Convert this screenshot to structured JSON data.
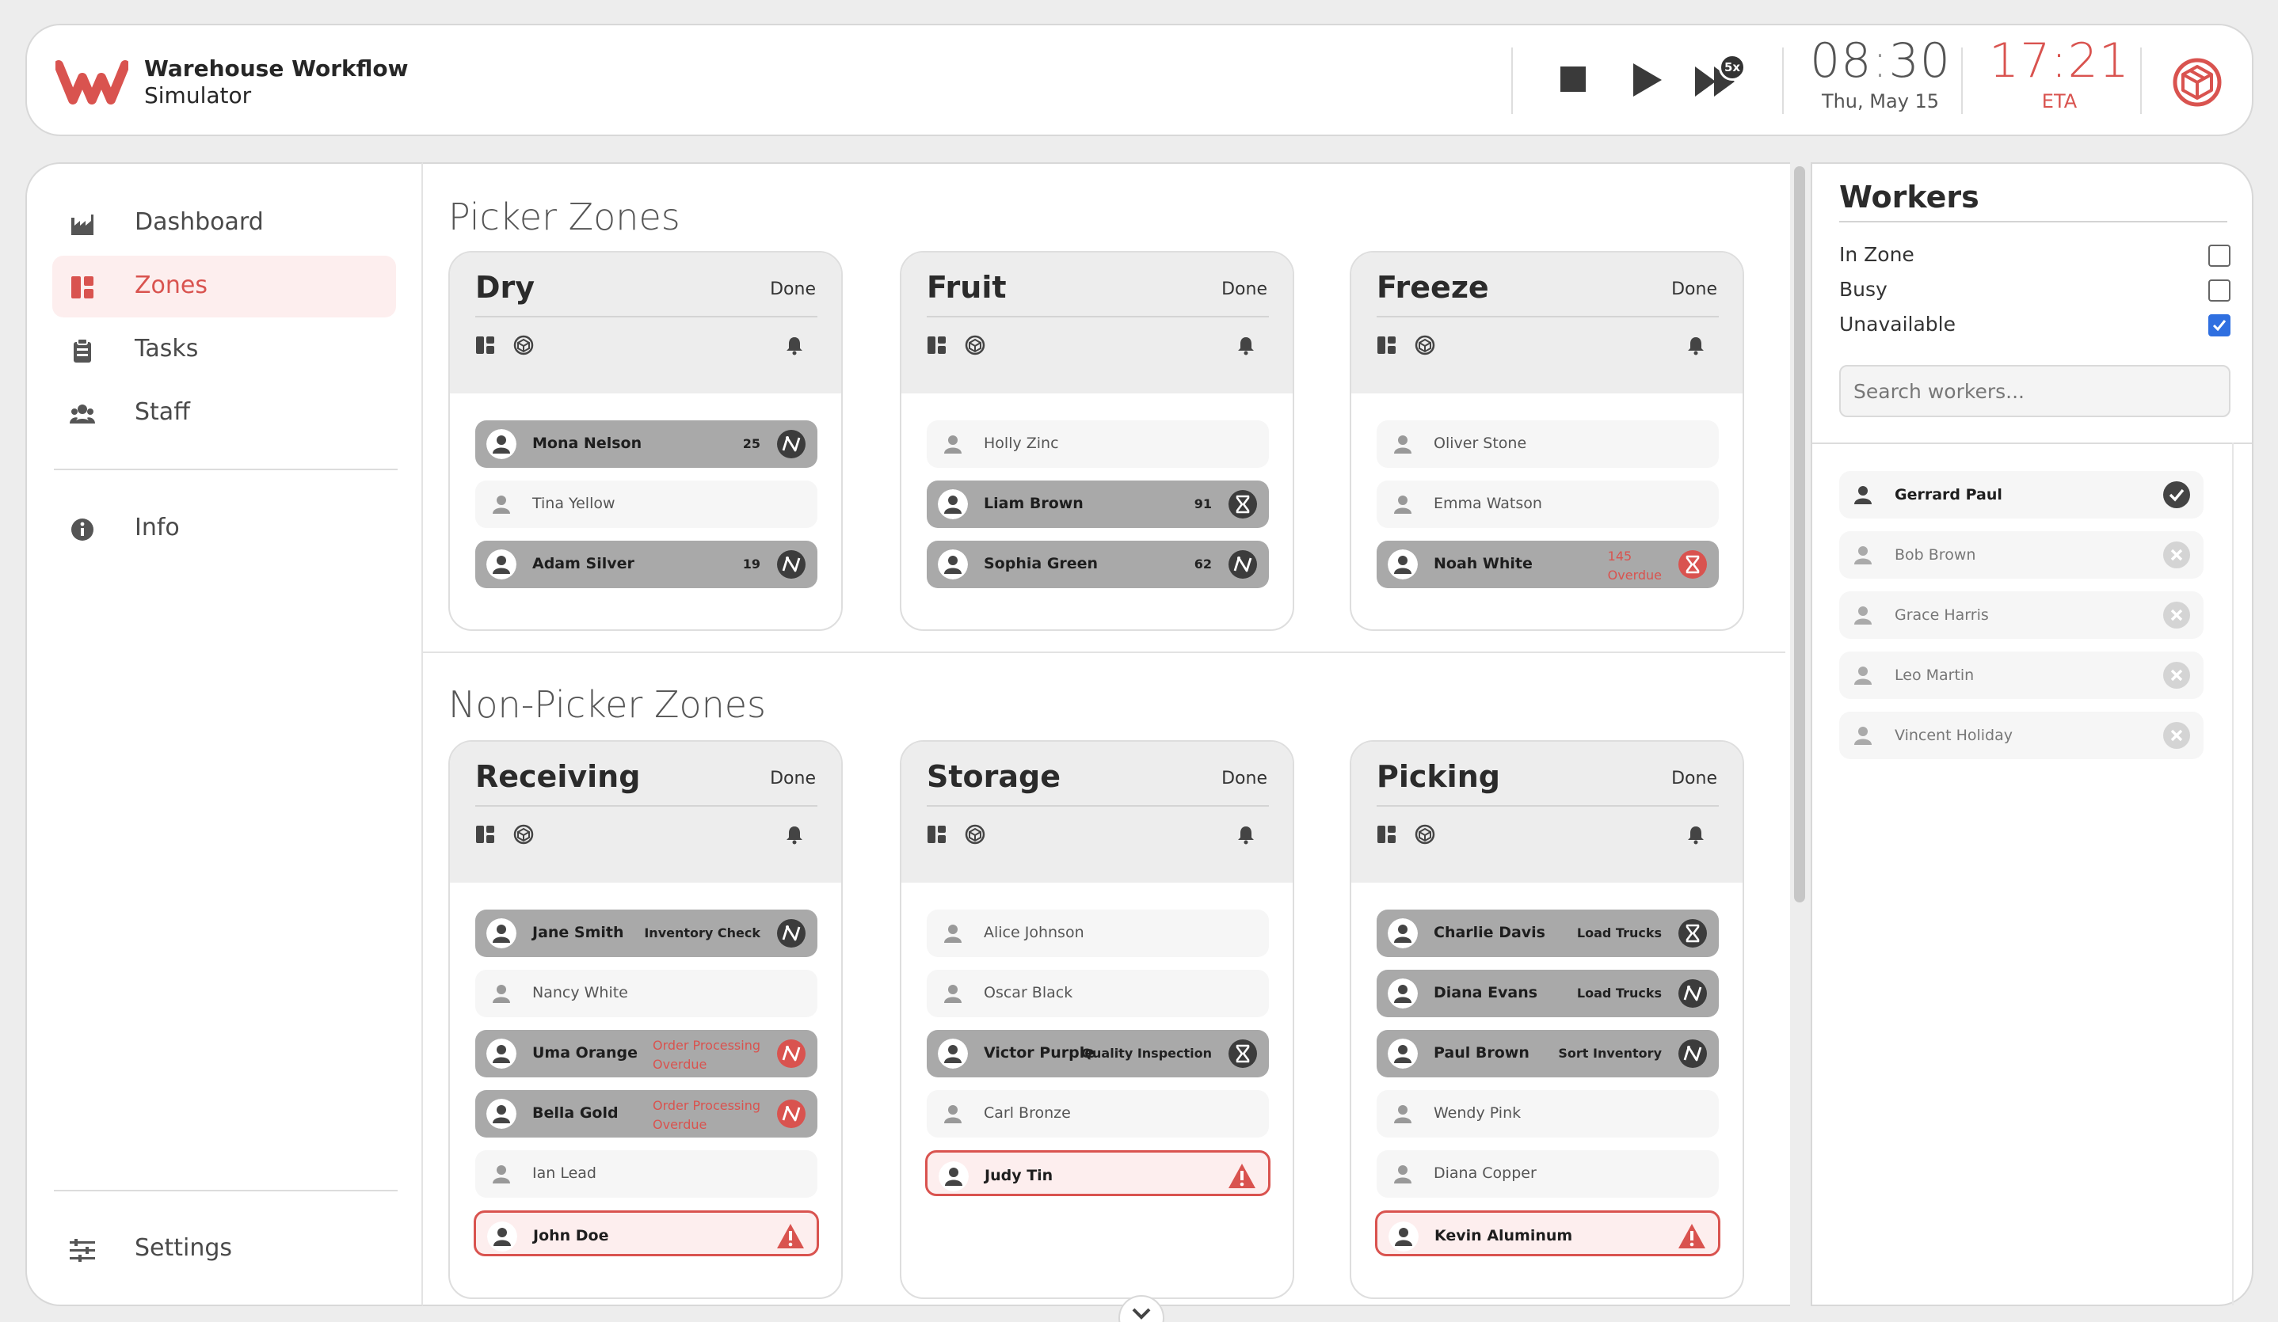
{
  "header": {
    "app_title_line1": "Warehouse Workflow",
    "app_title_line2": "Simulator",
    "clock_hours": "08",
    "clock_minutes": "30",
    "clock_date": "Thu, May 15",
    "eta_time": "17:21",
    "eta_label": "ETA",
    "speed_badge": "5x",
    "accent_color": "#d9534f"
  },
  "nav": {
    "items": [
      {
        "label": "Dashboard",
        "icon": "factory-icon"
      },
      {
        "label": "Zones",
        "icon": "zones-icon",
        "active": true
      },
      {
        "label": "Tasks",
        "icon": "clipboard-icon"
      },
      {
        "label": "Staff",
        "icon": "users-icon"
      }
    ],
    "info_label": "Info",
    "settings_label": "Settings"
  },
  "picker_section_title": "Picker Zones",
  "nonpicker_section_title": "Non-Picker Zones",
  "zones": [
    {
      "name": "Dry",
      "done_label": "Done",
      "workers": [
        {
          "name": "Mona Nelson",
          "task": "25",
          "state": "busy",
          "icon": "route-icon"
        },
        {
          "name": "Tina Yellow",
          "state": "idle"
        },
        {
          "name": "Adam Silver",
          "task": "19",
          "state": "busy",
          "icon": "route-icon"
        }
      ]
    },
    {
      "name": "Fruit",
      "done_label": "Done",
      "workers": [
        {
          "name": "Holly Zinc",
          "state": "idle"
        },
        {
          "name": "Liam Brown",
          "task": "91",
          "state": "busy",
          "icon": "hourglass-icon"
        },
        {
          "name": "Sophia Green",
          "task": "62",
          "state": "busy",
          "icon": "route-icon"
        }
      ]
    },
    {
      "name": "Freeze",
      "done_label": "Done",
      "workers": [
        {
          "name": "Oliver Stone",
          "state": "idle"
        },
        {
          "name": "Emma Watson",
          "state": "idle"
        },
        {
          "name": "Noah White",
          "task": "145",
          "sub": "Overdue",
          "state": "busy-overdue",
          "icon": "hourglass-icon"
        }
      ]
    },
    {
      "name": "Receiving",
      "done_label": "Done",
      "workers": [
        {
          "name": "Jane Smith",
          "task": "Inventory Check",
          "state": "busy",
          "icon": "route-icon"
        },
        {
          "name": "Nancy White",
          "state": "idle"
        },
        {
          "name": "Uma Orange",
          "task": "Order Processing",
          "sub": "Overdue",
          "state": "busy-overdue",
          "icon": "route-icon"
        },
        {
          "name": "Bella Gold",
          "task": "Order Processing",
          "sub": "Overdue",
          "state": "busy-overdue",
          "icon": "route-icon"
        },
        {
          "name": "Ian Lead",
          "state": "idle"
        },
        {
          "name": "John Doe",
          "state": "alert",
          "icon": "warning-icon"
        }
      ]
    },
    {
      "name": "Storage",
      "done_label": "Done",
      "workers": [
        {
          "name": "Alice Johnson",
          "state": "idle"
        },
        {
          "name": "Oscar Black",
          "state": "idle"
        },
        {
          "name": "Victor Purple",
          "task": "Quality Inspection",
          "state": "busy",
          "icon": "hourglass-icon"
        },
        {
          "name": "Carl Bronze",
          "state": "idle"
        },
        {
          "name": "Judy Tin",
          "state": "alert",
          "icon": "warning-icon"
        }
      ]
    },
    {
      "name": "Picking",
      "done_label": "Done",
      "workers": [
        {
          "name": "Charlie Davis",
          "task": "Load Trucks",
          "state": "busy",
          "icon": "hourglass-icon"
        },
        {
          "name": "Diana Evans",
          "task": "Load Trucks",
          "state": "busy",
          "icon": "route-icon"
        },
        {
          "name": "Paul Brown",
          "task": "Sort Inventory",
          "state": "busy",
          "icon": "route-icon"
        },
        {
          "name": "Wendy Pink",
          "state": "idle"
        },
        {
          "name": "Diana Copper",
          "state": "idle"
        },
        {
          "name": "Kevin Aluminum",
          "state": "alert",
          "icon": "warning-icon"
        }
      ]
    }
  ],
  "workers_panel": {
    "title": "Workers",
    "filters": [
      {
        "label": "In Zone",
        "checked": false
      },
      {
        "label": "Busy",
        "checked": false
      },
      {
        "label": "Unavailable",
        "checked": true
      }
    ],
    "search_placeholder": "Search workers...",
    "list": [
      {
        "name": "Gerrard Paul",
        "selected": true
      },
      {
        "name": "Bob Brown"
      },
      {
        "name": "Grace Harris"
      },
      {
        "name": "Leo Martin"
      },
      {
        "name": "Vincent Holiday"
      }
    ]
  }
}
